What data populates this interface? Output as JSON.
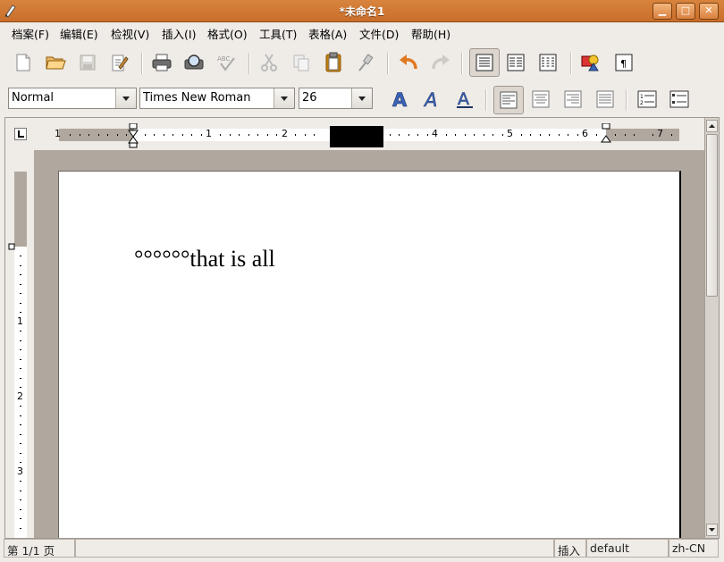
{
  "window": {
    "title": "*未命名1"
  },
  "menu": [
    "档案(F)",
    "编辑(E)",
    "检视(V)",
    "插入(I)",
    "格式(O)",
    "工具(T)",
    "表格(A)",
    "文件(D)",
    "帮助(H)"
  ],
  "format_bar": {
    "style": "Normal",
    "font": "Times New Roman",
    "size": "26"
  },
  "ruler": {
    "h_numbers": [
      "1",
      "1",
      "2",
      "4",
      "5",
      "6",
      "7"
    ],
    "v_numbers": [
      "1",
      "2",
      "3"
    ]
  },
  "document": {
    "text": "°°°°°°that is all"
  },
  "status": {
    "page": "第 1/1 页",
    "mode": "插入",
    "lang_style": "default",
    "locale": "zh-CN"
  },
  "colors": {
    "titlebar": "#d27a35",
    "accent_blue": "#3b63b8",
    "undo_orange": "#e07820"
  },
  "icons": {
    "toolbar": [
      "new-document-icon",
      "open-folder-icon",
      "save-icon",
      "edit-document-icon",
      "print-icon",
      "print-preview-icon",
      "spellcheck-icon",
      "cut-icon",
      "copy-icon",
      "paste-icon",
      "format-painter-icon",
      "undo-icon",
      "redo-icon",
      "one-column-icon",
      "two-columns-icon",
      "three-columns-icon",
      "insert-image-icon",
      "pilcrow-icon"
    ],
    "format": [
      "bold-icon",
      "italic-icon",
      "underline-icon",
      "align-left-icon",
      "align-center-icon",
      "align-right-icon",
      "justify-icon",
      "numbered-list-icon",
      "bullet-list-icon"
    ]
  }
}
